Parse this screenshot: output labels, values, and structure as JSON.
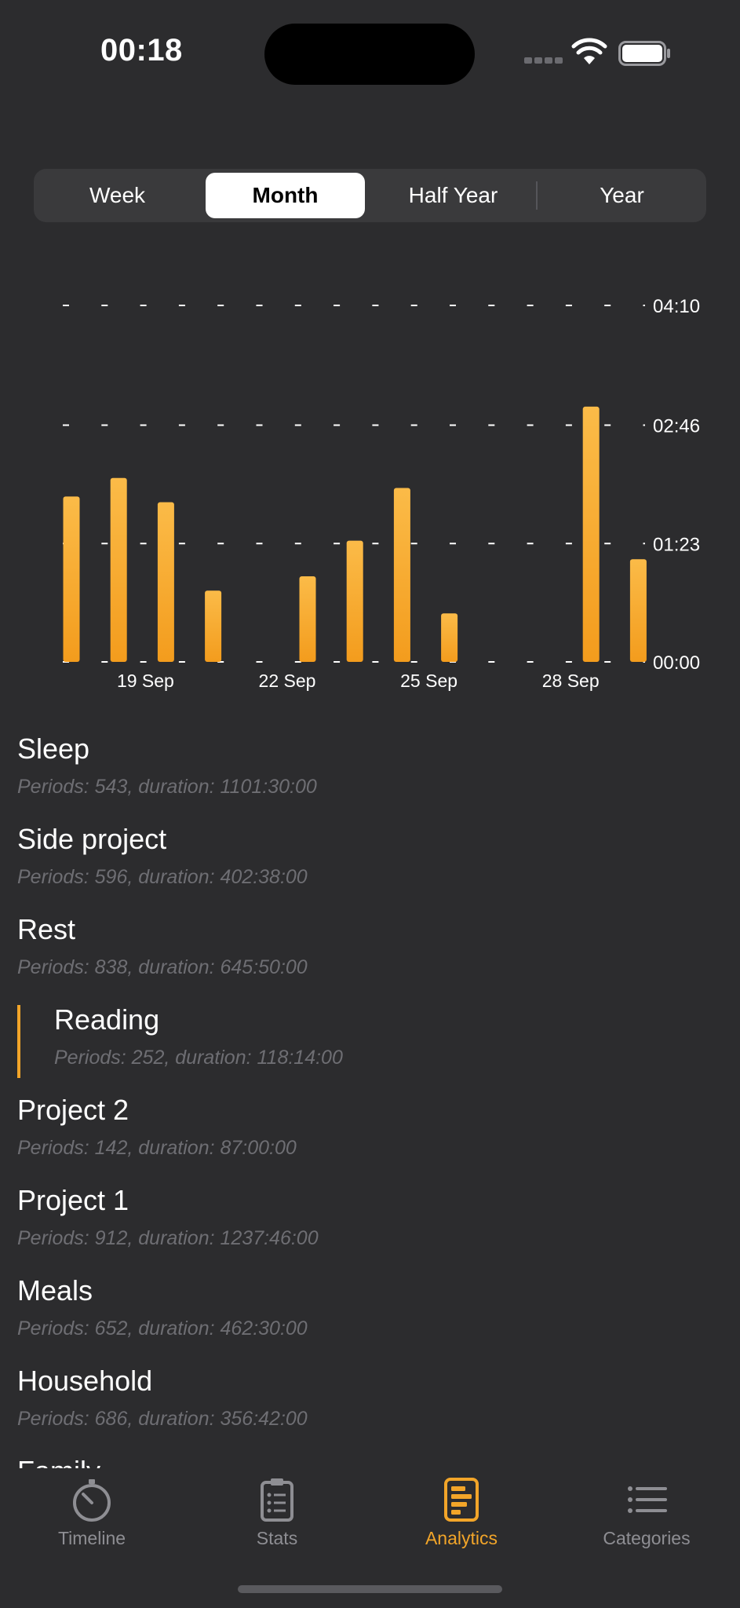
{
  "status_bar": {
    "time": "00:18"
  },
  "segmented": {
    "options": [
      "Week",
      "Month",
      "Half Year",
      "Year"
    ],
    "selected": "Month"
  },
  "chart_data": {
    "type": "bar",
    "y_tick_labels": [
      "00:00",
      "01:23",
      "02:46",
      "04:10"
    ],
    "y_ticks_minutes": [
      0,
      83,
      166,
      250
    ],
    "ylim_minutes": [
      0,
      250
    ],
    "x_tick_labels": [
      "19 Sep",
      "22 Sep",
      "25 Sep",
      "28 Sep"
    ],
    "categories": [
      "17 Sep",
      "18 Sep",
      "19 Sep",
      "20 Sep",
      "21 Sep",
      "22 Sep",
      "23 Sep",
      "24 Sep",
      "25 Sep",
      "26 Sep",
      "27 Sep",
      "28 Sep",
      "29 Sep"
    ],
    "values_minutes": [
      116,
      129,
      112,
      50,
      0,
      60,
      85,
      122,
      34,
      0,
      0,
      179,
      72
    ],
    "bar_color": "#f2a529",
    "grid": "dashed"
  },
  "categories_list": [
    {
      "name": "Sleep",
      "details": "Periods: 543, duration: 1101:30:00",
      "sub": false
    },
    {
      "name": "Side project",
      "details": "Periods: 596, duration: 402:38:00",
      "sub": false
    },
    {
      "name": "Rest",
      "details": "Periods: 838, duration: 645:50:00",
      "sub": false
    },
    {
      "name": "Reading",
      "details": "Periods: 252, duration: 118:14:00",
      "sub": true
    },
    {
      "name": "Project 2",
      "details": "Periods: 142, duration: 87:00:00",
      "sub": false
    },
    {
      "name": "Project 1",
      "details": "Periods: 912, duration: 1237:46:00",
      "sub": false
    },
    {
      "name": "Meals",
      "details": "Periods: 652, duration: 462:30:00",
      "sub": false
    },
    {
      "name": "Household",
      "details": "Periods: 686, duration: 356:42:00",
      "sub": false
    },
    {
      "name": "Family",
      "details": "",
      "sub": false
    }
  ],
  "tabbar": {
    "tabs": [
      {
        "label": "Timeline",
        "icon": "stopwatch-icon"
      },
      {
        "label": "Stats",
        "icon": "clipboard-icon"
      },
      {
        "label": "Analytics",
        "icon": "analytics-icon"
      },
      {
        "label": "Categories",
        "icon": "list-icon"
      }
    ],
    "active": "Analytics",
    "accent": "#f2a529",
    "inactive_color": "#8e8e93"
  }
}
